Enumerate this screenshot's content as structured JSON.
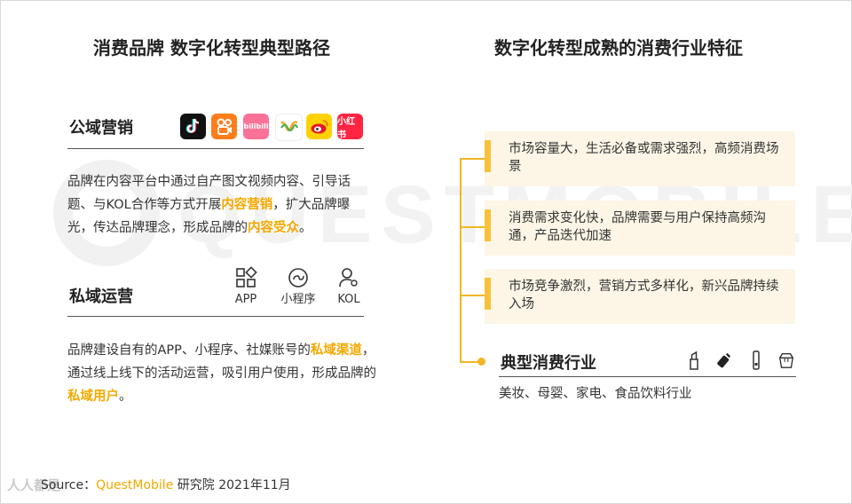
{
  "left": {
    "title": "消费品牌 数字化转型典型路径",
    "public": {
      "heading": "公域营销",
      "icons": [
        "douyin-icon",
        "kuaishou-icon",
        "bilibili-icon",
        "wechat-channels-icon",
        "weibo-icon",
        "xiaohongshu-icon"
      ],
      "bilibili_text": "bilibili",
      "xhs_text": "小红书",
      "text_a": "品牌在内容平台中通过自产图文视频内容、引导话题、与KOL合作等方式开展",
      "hl_a": "内容营销",
      "text_b": "，扩大品牌曝光，传达品牌理念，形成品牌的",
      "hl_b": "内容受众",
      "text_c": "。"
    },
    "private": {
      "heading": "私域运营",
      "icons": [
        {
          "name": "app-icon",
          "label": "APP"
        },
        {
          "name": "mini-program-icon",
          "label": "小程序"
        },
        {
          "name": "kol-icon",
          "label": "KOL"
        }
      ],
      "text_a": "品牌建设自有的APP、小程序、社媒账号的",
      "hl_a": "私域渠道",
      "text_b": "，通过线上线下的活动运营，吸引用户使用，形成品牌的",
      "hl_b": "私域用户",
      "text_c": "。"
    }
  },
  "right": {
    "title": "数字化转型成熟的消费行业特征",
    "cards": [
      "市场容量大，生活必备或需求强烈，高频消费场景",
      "消费需求变化快，品牌需要与用户保持高频沟通，产品迭代加速",
      "市场竞争激烈，营销方式多样化，新兴品牌持续入场"
    ],
    "industry": {
      "heading": "典型消费行业",
      "icons": [
        "lipstick-icon",
        "baby-bottle-icon",
        "electric-toothbrush-icon",
        "food-box-icon"
      ],
      "text": "美妆、母婴、家电、食品饮料行业"
    }
  },
  "footer": {
    "source_label": "Source：",
    "brand": "QuestMobile",
    "rest": " 研究院 2021年11月",
    "corner_mark": "人人都是"
  },
  "colors": {
    "accent": "#f2a900",
    "card_bg": "#fdf6e6",
    "tree": "#f2b624"
  }
}
